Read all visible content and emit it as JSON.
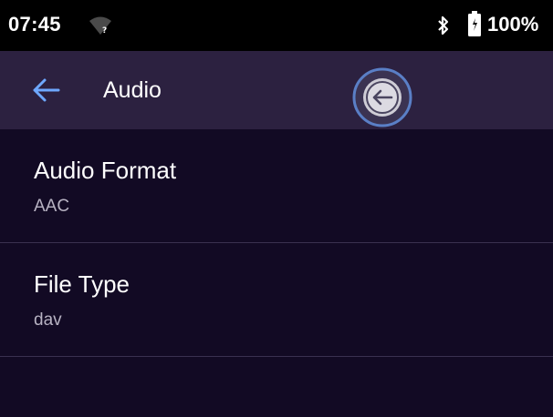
{
  "status_bar": {
    "time": "07:45",
    "wifi_icon": "wifi-unknown-icon",
    "bluetooth_icon": "bluetooth-icon",
    "battery_icon": "battery-icon",
    "battery_level": "100%"
  },
  "app_bar": {
    "back_icon": "arrow-left-icon",
    "title": "Audio",
    "floating_back_icon": "circle-arrow-left-icon"
  },
  "settings": [
    {
      "title": "Audio Format",
      "value": "AAC"
    },
    {
      "title": "File Type",
      "value": "dav"
    }
  ],
  "colors": {
    "background": "#120a24",
    "app_bar": "#2c2140",
    "accent": "#6ea8ff",
    "divider": "#3a3150",
    "secondary_text": "#b7b2c2"
  }
}
